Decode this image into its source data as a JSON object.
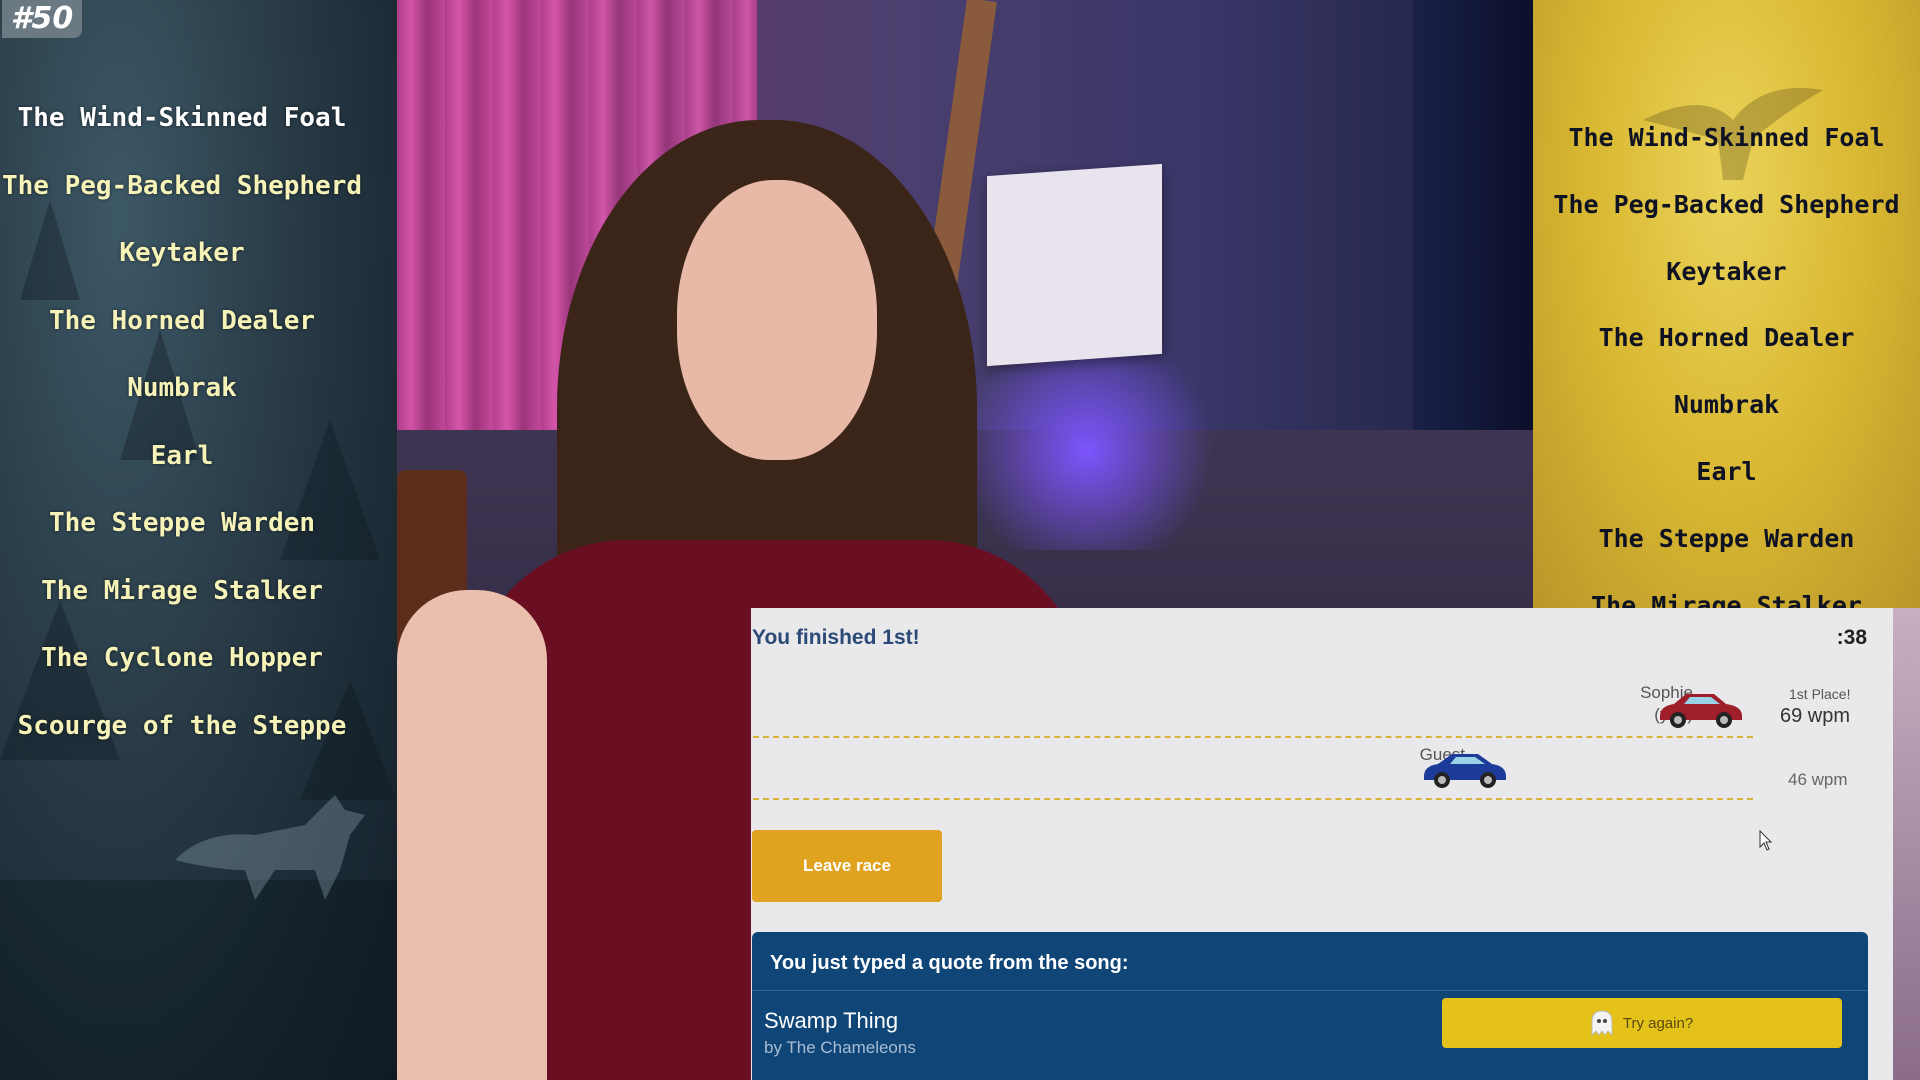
{
  "badge": "#50",
  "left_list": [
    "The Wind-Skinned Foal",
    "The Peg-Backed Shepherd",
    "Keytaker",
    "The Horned Dealer",
    "Numbrak",
    "Earl",
    "The Steppe Warden",
    "The Mirage Stalker",
    "The Cyclone Hopper",
    "Scourge of the Steppe"
  ],
  "right_list": [
    "The Wind-Skinned Foal",
    "The Peg-Backed Shepherd",
    "Keytaker",
    "The Horned Dealer",
    "Numbrak",
    "Earl",
    "The Steppe Warden",
    "The Mirage Stalker"
  ],
  "race": {
    "finish_message": "You finished 1st!",
    "timer": ":38",
    "racers": [
      {
        "name": "Sophie",
        "sub": "(you)",
        "place": "1st Place!",
        "wpm": "69 wpm",
        "car_color": "#9e1f2a"
      },
      {
        "name": "Guest",
        "sub": "",
        "place": "",
        "wpm": "46 wpm",
        "car_color": "#1d3c9a"
      }
    ],
    "leave_label": "Leave race",
    "quote_heading": "You just typed a quote from the song:",
    "song_title": "Swamp Thing",
    "song_artist": "by The Chameleons",
    "try_again_label": "Try again?"
  }
}
